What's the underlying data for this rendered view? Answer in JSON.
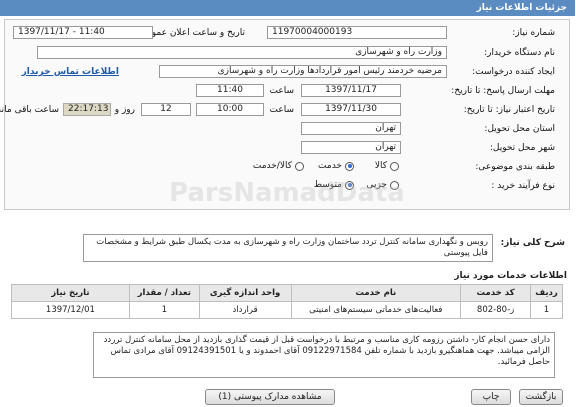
{
  "header": {
    "title": "جزئیات اطلاعات نیاز"
  },
  "form": {
    "need_number_label": "شماره نیاز:",
    "need_number": "11970004000193",
    "announce_label": "تاریخ و ساعت اعلان عمومی:",
    "announce_value": "1397/11/17 - 11:40",
    "buyer_label": "نام دستگاه خریدار:",
    "buyer_value": "وزارت راه و شهرسازی",
    "creator_label": "ایجاد کننده درخواست:",
    "creator_value": "مرضیه خردمند رئیس امور قراردادها وزارت راه و شهرسازی",
    "contact_link": "اطلاعات تماس خریدار",
    "send_deadline_label": "مهلت ارسال پاسخ: تا تاریخ:",
    "send_date": "1397/11/17",
    "time_label": "ساعت",
    "send_time": "11:40",
    "validity_label": "تاریخ اعتبار نیاز: تا تاریخ:",
    "validity_date": "1397/11/30",
    "validity_time": "10:00",
    "days_count": "12",
    "day_and_label": "روز و",
    "remain_time": "22:17:13",
    "remain_label": "ساعت باقی مانده",
    "province_label": "استان محل تحویل:",
    "province_value": "تهران",
    "city_label": "شهر محل تحویل:",
    "city_value": "تهران",
    "category_label": "طبقه بندی موضوعی:",
    "category_options": [
      "کالا",
      "خدمت",
      "کالا/خدمت"
    ],
    "category_selected": "خدمت",
    "process_label": "نوع فرآیند خرید :",
    "process_options": [
      "جزیی",
      "متوسط"
    ],
    "process_selected": "متوسط"
  },
  "general_desc": {
    "label": "شرح کلی نیاز:",
    "text": "روبس و نگهداری سامانه کنترل تردد ساختمان وزارت راه و شهرسازی به مدت یکسال طبق شرایط  و مشخصات فایل پیوستی"
  },
  "services": {
    "section_title": "اطلاعات خدمات مورد نیاز",
    "columns": [
      "ردیف",
      "کد خدمت",
      "نام خدمت",
      "واحد اندازه گیری",
      "تعداد / مقدار",
      "تاریخ نیاز"
    ],
    "rows": [
      [
        "1",
        "ز-80-802",
        "فعالیت‌های خدماتی سیستم‌های امنیتی",
        "قرارداد",
        "1",
        "1397/12/01"
      ]
    ]
  },
  "buyer_notes": {
    "text": "دارای حسن انجام کار- داشتن رزومه کاری مناسب و مرتبط با درخواست قبل از قیمت گذاری بازدید از محل سامانه کنترل ترردد الزامی میباشد. جهت هماهنگیرو بازدید با شماره تلفن 09122971584 آقای احمدوند و یا 09124391501 آقای مرادی تماس حاصل فرمائید."
  },
  "footer": {
    "back_label": "بازگشت",
    "print_label": "چاپ",
    "attachments_label": "مشاهده مدارک پیوستی (1)"
  },
  "watermark": {
    "text": "ParsNamadData"
  }
}
